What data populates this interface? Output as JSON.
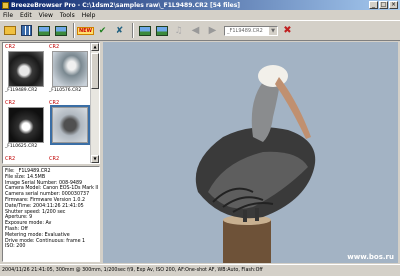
{
  "window": {
    "title": "BreezeBrowser Pro - C:\\1dsm2\\samples raw\\_F1L9489.CR2 [54 files]"
  },
  "menu": [
    "File",
    "Edit",
    "View",
    "Tools",
    "Help"
  ],
  "toolbar": {
    "new_label": "NEW",
    "file_combo": "_F1L9489.CR2"
  },
  "thumbnails": [
    {
      "tag": "CR2",
      "name": "_F1L9489.CR2",
      "selected": false
    },
    {
      "tag": "CR2",
      "name": "_F1L0576.CR2",
      "selected": false
    },
    {
      "tag": "CR2",
      "name": "_F1L0625.CR2",
      "selected": false
    },
    {
      "tag": "CR2",
      "name": "",
      "selected": true
    },
    {
      "tag": "CR2",
      "name": "",
      "selected": false
    },
    {
      "tag": "CR2",
      "name": "",
      "selected": false
    }
  ],
  "info": [
    "File: _F1L9489.CR2",
    "File size: 14.5MB",
    "Image Serial Number: 008-9489",
    "Camera Model: Canon EOS-1Ds Mark II",
    "Camera serial number: 000030737",
    "Firmware: Firmware Version 1.0.2",
    "Date/Time: 2004:11:26 21:41:05",
    "Shutter speed: 1/200 sec",
    "Aperture: 9",
    "Exposure mode: Av",
    "Flash: Off",
    "Metering mode: Evaluative",
    "Drive mode: Continuous: frame 1",
    "ISO: 200"
  ],
  "status": "2004/11/26 21:41:05, 300mm @ 300mm, 1/200sec f/9, Exp Av, ISO 200, AF:One-shot AF, WB:Auto, Flash:Off",
  "watermark": "www.bos.ru"
}
